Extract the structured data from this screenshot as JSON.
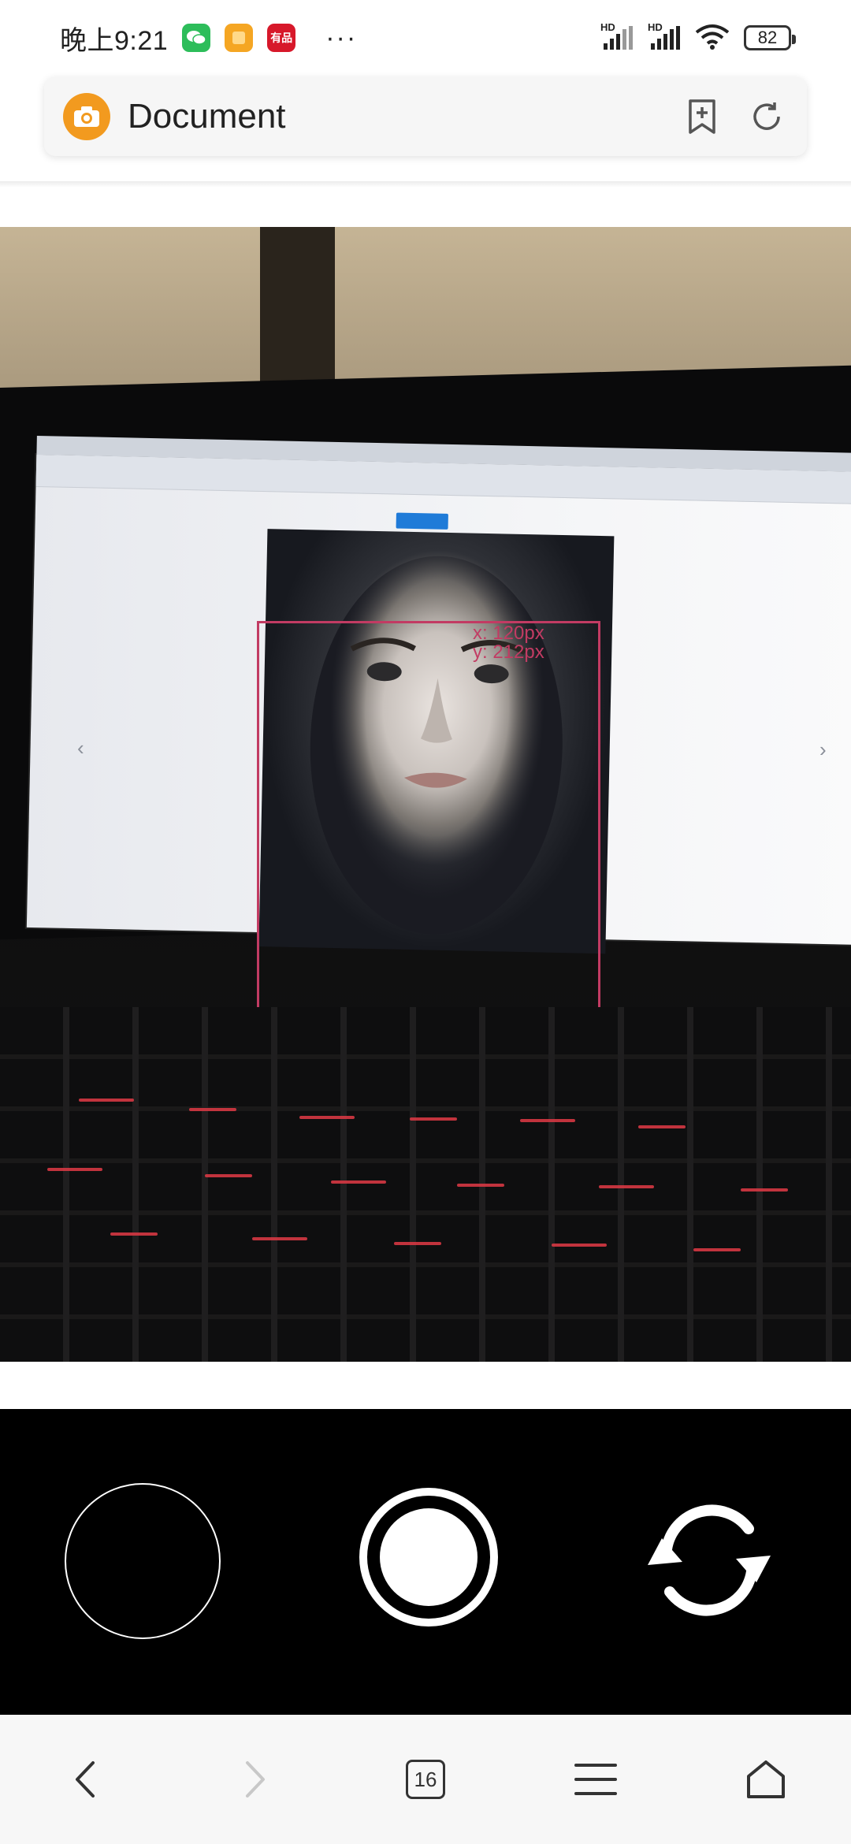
{
  "status_bar": {
    "time": "晚上9:21",
    "apps": [
      {
        "name": "wechat",
        "color": "#2dbd5a"
      },
      {
        "name": "notes",
        "color": "#f5a623"
      },
      {
        "name": "shop",
        "color": "#d7182a",
        "label": "有品"
      }
    ],
    "more": "···",
    "signal_1": "HD",
    "signal_2": "HD",
    "battery": "82"
  },
  "address_bar": {
    "title": "Document",
    "icon": "camera-icon",
    "accent": "#f29a1f",
    "actions": [
      "bookmark-add-icon",
      "reload-icon"
    ]
  },
  "preview": {
    "coord_x": "x: 120px",
    "coord_y": "y: 212px",
    "box_color": "#c23b63"
  },
  "camera_controls": {
    "buttons": [
      "gallery-button",
      "shutter-button",
      "switch-camera-button"
    ]
  },
  "bottom_nav": {
    "tabs_count": "16",
    "items": [
      "back-icon",
      "forward-icon",
      "tabs-icon",
      "menu-icon",
      "home-icon"
    ]
  }
}
